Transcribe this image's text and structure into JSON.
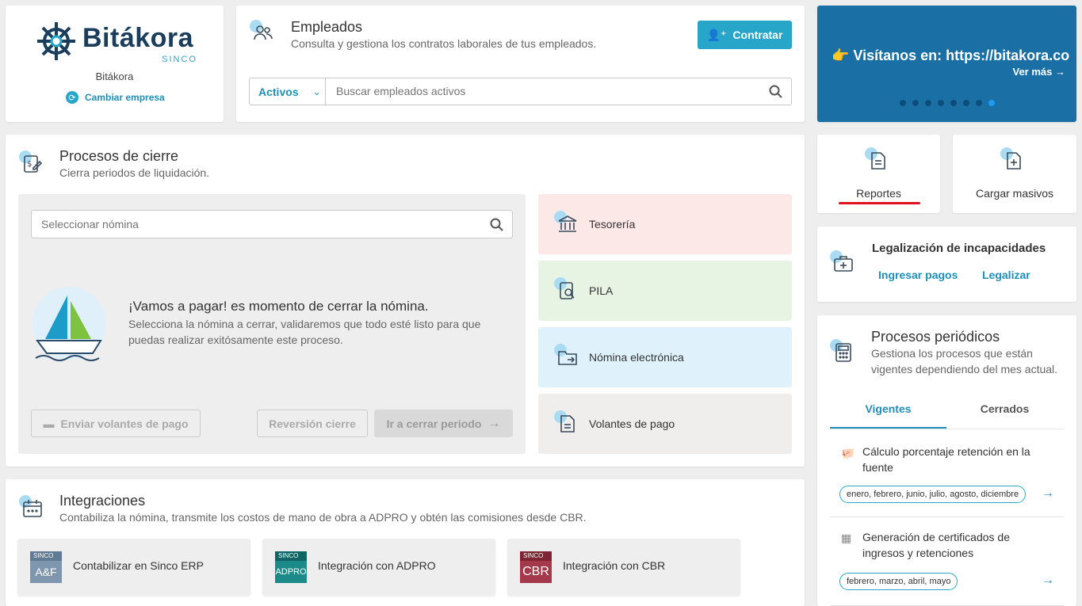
{
  "company": {
    "logo_word": "Bitákora",
    "logo_sub": "SINCO",
    "name": "Bitákora",
    "change_label": "Cambiar empresa"
  },
  "employees": {
    "title": "Empleados",
    "subtitle": "Consulta y gestiona los contratos laborales de tus empleados.",
    "hire_label": "Contratar",
    "filter_value": "Activos",
    "search_placeholder": "Buscar empleados activos"
  },
  "banner": {
    "text": "👉 Visítanos en: https://bitakora.co",
    "more_label": "Ver más →",
    "slide_count": 8,
    "active_slide": 8,
    "bg_color": "#1a70a5"
  },
  "closing": {
    "title": "Procesos de cierre",
    "subtitle": "Cierra periodos de liquidación.",
    "select_placeholder": "Seleccionar nómina",
    "promo_title": "¡Vamos a pagar! es momento de cerrar la nómina.",
    "promo_text": "Selecciona la nómina a cerrar, validaremos que todo esté listo para que puedas realizar exitósamente este proceso.",
    "send_label": "Enviar volantes de pago",
    "revert_label": "Reversión cierre",
    "close_label": "Ir a cerrar periodo",
    "tiles": [
      {
        "label": "Tesorería",
        "color": "#fde8e8"
      },
      {
        "label": "PILA",
        "color": "#e7f4e4"
      },
      {
        "label": "Nómina electrónica",
        "color": "#dff2fb"
      },
      {
        "label": "Volantes de pago",
        "color": "#efeeed"
      }
    ]
  },
  "shortcuts": {
    "reports_label": "Reportes",
    "bulk_label": "Cargar masivos"
  },
  "incapacities": {
    "title": "Legalización de incapacidades",
    "pay_label": "Ingresar pagos",
    "legalize_label": "Legalizar"
  },
  "periodic": {
    "title": "Procesos periódicos",
    "subtitle": "Gestiona los procesos que están vigentes dependiendo del mes actual.",
    "tab_current": "Vigentes",
    "tab_closed": "Cerrados",
    "items": [
      {
        "title": "Cálculo porcentaje retención en la fuente",
        "months": "enero, febrero, junio, julio, agosto, diciembre"
      },
      {
        "title": "Generación de certificados de ingresos y retenciones",
        "months": "febrero, marzo, abril, mayo"
      }
    ]
  },
  "integrations": {
    "title": "Integraciones",
    "subtitle": "Contabiliza la nómina, transmite los costos de mano de obra a ADPRO y obtén las comisiones desde CBR.",
    "items": [
      {
        "badge_top": "SINCO",
        "badge": "A&F",
        "label": "Contabilizar en Sinco ERP",
        "color": "#7e97ae"
      },
      {
        "badge_top": "SINCO",
        "badge": "ADPRO",
        "label": "Integración con ADPRO",
        "color": "#1d8a8a"
      },
      {
        "badge_top": "SINCO",
        "badge": "CBR",
        "label": "Integración con CBR",
        "color": "#a3394a"
      }
    ]
  }
}
